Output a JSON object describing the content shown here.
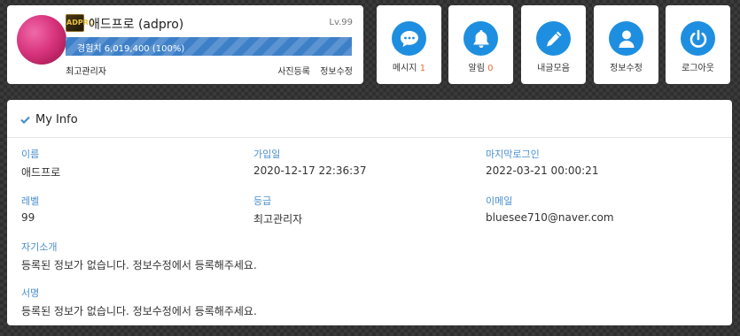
{
  "profile": {
    "nickname": "애드프로 (adpro)",
    "level": "Lv.99",
    "level_badge": "ADPRO",
    "exp_text": "경험치 6,019,400 (100%)",
    "exp_percent": 100,
    "grade": "최고관리자",
    "links": [
      "사진등록",
      "정보수정"
    ]
  },
  "menu": [
    {
      "label": "메시지",
      "count": "1",
      "icon": "speech-bubble-icon"
    },
    {
      "label": "알림",
      "count": "0",
      "icon": "bell-icon"
    },
    {
      "label": "내글모음",
      "count": "",
      "icon": "pencil-icon"
    },
    {
      "label": "정보수정",
      "count": "",
      "icon": "user-icon"
    },
    {
      "label": "로그아웃",
      "count": "",
      "icon": "power-icon"
    }
  ],
  "info": {
    "title": "My Info",
    "name": {
      "label": "이름",
      "value": "애드프로"
    },
    "join": {
      "label": "가입일",
      "value": "2020-12-17 22:36:37"
    },
    "last_login": {
      "label": "마지막로그인",
      "value": "2022-03-21 00:00:21"
    },
    "level": {
      "label": "레벨",
      "value": "99"
    },
    "grade": {
      "label": "등급",
      "value": "최고관리자"
    },
    "email": {
      "label": "이메일",
      "value": "bluesee710@naver.com"
    },
    "intro": {
      "label": "자기소개",
      "value": "등록된 정보가 없습니다. 정보수정에서 등록해주세요."
    },
    "signature": {
      "label": "서명",
      "value": "등록된 정보가 없습니다. 정보수정에서 등록해주세요."
    }
  },
  "colors": {
    "accent": "#1e8fe0",
    "exp_bar": "#3d80c8",
    "count": "#f06a35",
    "field_label": "#4a8fcf"
  }
}
